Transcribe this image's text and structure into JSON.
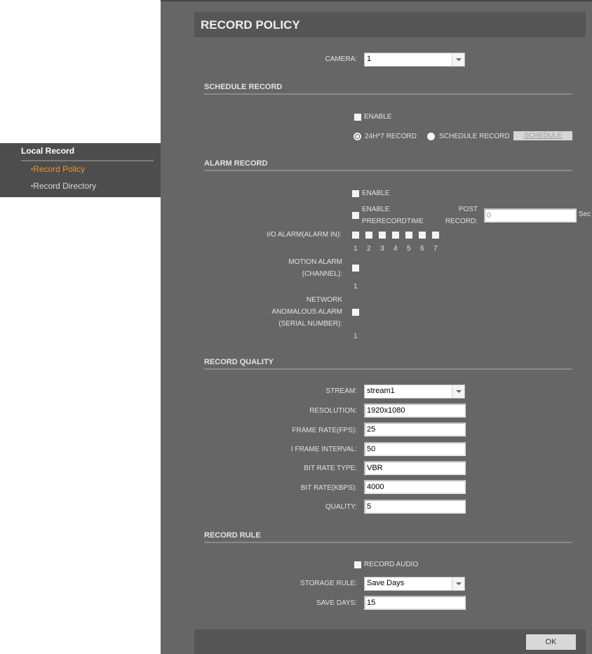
{
  "sidebar": {
    "title": "Local Record",
    "items": [
      {
        "label": "Record Policy",
        "active": true
      },
      {
        "label": "Record Directory",
        "active": false
      }
    ],
    "bullet": "•"
  },
  "page": {
    "title": "RECORD POLICY",
    "camera_label": "CAMERA:",
    "camera_value": "1"
  },
  "schedule_record": {
    "heading": "SCHEDULE RECORD",
    "enable_label": "ENABLE",
    "enable_checked": false,
    "radio_24h_label": "24H*7 RECORD",
    "radio_schedule_label": "SCHEDULE RECORD",
    "selected": "24H*7 RECORD",
    "schedule_button": "SCHEDULE"
  },
  "alarm_record": {
    "heading": "ALARM RECORD",
    "enable_label": "ENABLE",
    "enable_prerecord_label_1": "ENABLE",
    "enable_prerecord_label_2": "PRERECORDTIME",
    "post_record_label_1": "POST",
    "post_record_label_2": "RECORD:",
    "post_record_value": "0",
    "post_record_unit": "Sec",
    "io_alarm_label": "I/O ALARM(ALARM IN):",
    "io_alarm_channels": [
      "1",
      "2",
      "3",
      "4",
      "5",
      "6",
      "7"
    ],
    "motion_label_1": "MOTION ALARM",
    "motion_label_2": "(CHANNEL):",
    "motion_channels": [
      "1"
    ],
    "network_label_1": "NETWORK",
    "network_label_2": "ANOMALOUS ALARM",
    "network_label_3": "(SERIAL NUMBER):",
    "network_channels": [
      "1"
    ]
  },
  "record_quality": {
    "heading": "RECORD QUALITY",
    "fields": [
      {
        "label": "STREAM:",
        "value": "stream1",
        "type": "select"
      },
      {
        "label": "RESOLUTION:",
        "value": "1920x1080",
        "type": "input"
      },
      {
        "label": "FRAME RATE(FPS):",
        "value": "25",
        "type": "input"
      },
      {
        "label": "I FRAME INTERVAL:",
        "value": "50",
        "type": "input"
      },
      {
        "label": "BIT RATE TYPE:",
        "value": "VBR",
        "type": "input"
      },
      {
        "label": "BIT RATE(KBPS):",
        "value": "4000",
        "type": "input"
      },
      {
        "label": "QUALITY:",
        "value": "5",
        "type": "input"
      }
    ]
  },
  "record_rule": {
    "heading": "RECORD RULE",
    "record_audio_label": "RECORD AUDIO",
    "record_audio_checked": false,
    "storage_rule_label": "STORAGE RULE:",
    "storage_rule_value": "Save Days",
    "save_days_label": "SAVE DAYS:",
    "save_days_value": "15"
  },
  "footer": {
    "ok_label": "OK"
  },
  "colors": {
    "panel_bg": "#666666",
    "header_bg": "#555555",
    "sidebar_bg": "#4d4d4d",
    "active_item": "#f0922e"
  }
}
